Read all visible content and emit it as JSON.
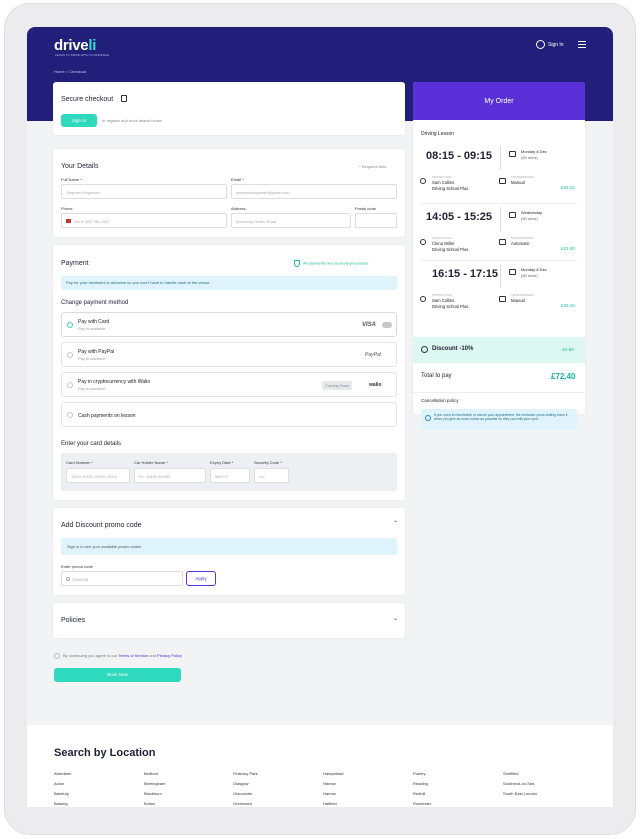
{
  "brand": {
    "logo_main": "drive",
    "logo_accent": "li",
    "tagline": "LEARN TO DRIVE WITH CONFIDENCE"
  },
  "header": {
    "signin": "Sign In",
    "breadcrumb": "Home > Checkout"
  },
  "secure": {
    "title": "Secure checkout",
    "signin_button": "Sign In",
    "or_text": "or register and book lesson below"
  },
  "details": {
    "title": "Your Details",
    "required": "* Required field",
    "full_name_label": "Full Name *",
    "full_name_value": "Stephen Kingsman",
    "email_label": "Email *",
    "email_value": "stephenkingsman@gmail.com",
    "phone_label": "Phone",
    "phone_prefix": "+44",
    "phone_value": "283 786 2422",
    "address_label": "Address",
    "address_value": "Bonderay Green Road",
    "postcode_label": "Postal code",
    "postcode_value": ""
  },
  "payment": {
    "title": "Payment",
    "secure_note": "All payments are securely processed",
    "info": "Pay for your treatment in advance so you won't have to handle cash at the venue.",
    "change_title": "Change payment method",
    "options": [
      {
        "title": "Pay with Card",
        "sub": "Pay in advance",
        "badge": "VISA"
      },
      {
        "title": "Pay with PayPal",
        "sub": "Pay in advance",
        "badge": "PayPal"
      },
      {
        "title": "Pay in cryptocurrency with Walio",
        "sub": "Pay in advance",
        "coming": "Coming Soon",
        "badge": "walio"
      },
      {
        "title": "Cash payments on lesson",
        "sub": "",
        "badge": ""
      }
    ],
    "card_title": "Enter your card details",
    "card_number_label": "Card Number *",
    "card_number_ph": "XXXX XXXX XXXX XXXX",
    "holder_label": "Car Holder Name *",
    "holder_ph": "Ex. JOHN WYNN",
    "expiry_label": "Expiry Date *",
    "expiry_ph": "MM/YY",
    "code_label": "Security Code *",
    "code_ph": "••••"
  },
  "discount": {
    "title": "Add Discount promo code",
    "signin_note": "Sign in to see your available promo codes",
    "sign_link": "Sign in",
    "promo_label": "Enter promo code",
    "promo_value": "SZ#6928",
    "apply": "Apply"
  },
  "policies": {
    "title": "Policies"
  },
  "agree": {
    "prefix": "By continuing you agree to our",
    "terms": "Terms of Service",
    "and": "and",
    "privacy": "Privacy Policy"
  },
  "book_now": "Book Now",
  "order": {
    "title": "My Order",
    "section": "Driving Lesson",
    "lessons": [
      {
        "time": "08:15 - 09:15",
        "day": "Monday 8 Dec",
        "mins": "(60 mins)",
        "role": "INSTRUCTOR",
        "name": "Sam Collins",
        "school": "Driving School Plus",
        "trans_label": "TRANSMISSION",
        "trans": "Manual",
        "price": "£25.10"
      },
      {
        "time": "14:05 - 15:25",
        "day": "Wednesday",
        "mins": "(90 mins)",
        "role": "INSTRUCTOR",
        "name": "Clena Willer",
        "school": "Driving School Plus",
        "trans_label": "TRANSMISSION",
        "trans": "Automatic",
        "price": "£22.40"
      },
      {
        "time": "16:15 - 17:15",
        "day": "Monday 8 Dec",
        "mins": "(60 mins)",
        "role": "INSTRUCTOR",
        "name": "Sam Collins",
        "school": "Driving School Plus",
        "trans_label": "TRANSMISSION",
        "trans": "Manual",
        "price": "£25.10"
      }
    ],
    "discount_label": "Discount -10%",
    "discount_value": "-£2.50",
    "total_label": "Total to pay",
    "total_value": "£72.40",
    "cancel_title": "Cancellation policy",
    "cancel_text": "If you need to reschedule or cancel your appointment, the instructor yours visiting loses it when you give as much notice as possible so they can refill your spot."
  },
  "search": {
    "title": "Search by Location",
    "columns": [
      [
        "Aberdeen",
        "Acton",
        "Banbury",
        "Barking"
      ],
      [
        "Bedford",
        "Birmingham",
        "Blackburn",
        "Bolton"
      ],
      [
        "Finsbury Park",
        "Glasgow",
        "Gloucester",
        "Greenwich"
      ],
      [
        "Hampstead",
        "Harrow",
        "Harrow",
        "Hatfield"
      ],
      [
        "Putney",
        "Reading",
        "Redhill",
        "Rochester"
      ],
      [
        "Sheffield",
        "Southend-on-Sea",
        "South East London"
      ]
    ]
  },
  "colors": {
    "primary": "#221f7a",
    "accent": "#2fd9bd",
    "order_header": "#5a30d8"
  }
}
